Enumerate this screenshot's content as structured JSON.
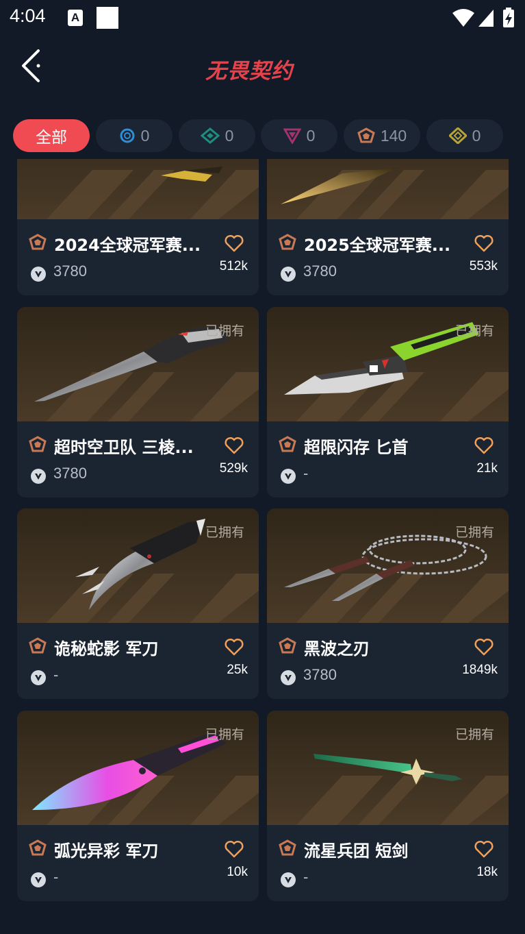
{
  "status_bar": {
    "time": "4:04",
    "notif_letter": "A"
  },
  "header": {
    "title": "无畏契约"
  },
  "filters": [
    {
      "label": "全部",
      "active": true
    },
    {
      "icon": "tier-select-icon",
      "count": "0",
      "color": "#2f8fd6"
    },
    {
      "icon": "tier-deluxe-icon",
      "count": "0",
      "color": "#1e8e7f"
    },
    {
      "icon": "tier-premium-icon",
      "count": "0",
      "color": "#a2336d"
    },
    {
      "icon": "tier-exclusive-icon",
      "count": "140",
      "color": "#c97a55"
    },
    {
      "icon": "tier-ultra-icon",
      "count": "0",
      "color": "#b8a23a"
    }
  ],
  "items": [
    {
      "name": "2024全球冠军赛...",
      "price": "3780",
      "likes": "512k",
      "owned": "",
      "weapon": "champ-2024-knife"
    },
    {
      "name": "2025全球冠军赛...",
      "price": "3780",
      "likes": "553k",
      "owned": "",
      "weapon": "champ-2025-knife"
    },
    {
      "name": "超时空卫队 三棱...",
      "price": "3780",
      "likes": "529k",
      "owned": "已拥有",
      "weapon": "silver-knife"
    },
    {
      "name": "超限闪存 匕首",
      "price": "-",
      "likes": "21k",
      "owned": "已拥有",
      "weapon": "green-knife"
    },
    {
      "name": "诡秘蛇影 军刀",
      "price": "-",
      "likes": "25k",
      "owned": "已拥有",
      "weapon": "karambit"
    },
    {
      "name": "黑波之刃",
      "price": "3780",
      "likes": "1849k",
      "owned": "已拥有",
      "weapon": "chain-kunai"
    },
    {
      "name": "弧光异彩 军刀",
      "price": "-",
      "likes": "10k",
      "owned": "已拥有",
      "weapon": "neon-knife"
    },
    {
      "name": "流星兵团 短剑",
      "price": "-",
      "likes": "18k",
      "owned": "已拥有",
      "weapon": "jade-sword"
    }
  ],
  "colors": {
    "accent": "#f04b53",
    "tier_exclusive": "#c97a55",
    "heart": "#f0a05a"
  }
}
